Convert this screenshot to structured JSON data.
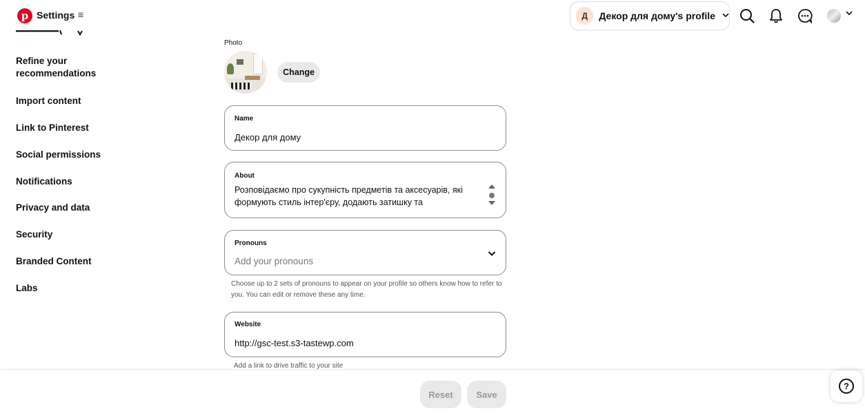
{
  "header": {
    "logo_letter": "p",
    "title": "Settings",
    "menu_glyph": "≡",
    "profile": {
      "initial": "Д",
      "name": "Декор для дому's profile"
    }
  },
  "sidebar": {
    "items": [
      "Refine your recommendations",
      "Import content",
      "Link to Pinterest",
      "Social permissions",
      "Notifications",
      "Privacy and data",
      "Security",
      "Branded Content",
      "Labs"
    ]
  },
  "profile_form": {
    "photo_label": "Photo",
    "change_label": "Change",
    "name": {
      "label": "Name",
      "value": "Декор для дому"
    },
    "about": {
      "label": "About",
      "value": "Розповідаємо про сукупність предметів та аксесуарів, які формують стиль інтер'єру, додають затишку та"
    },
    "pronouns": {
      "label": "Pronouns",
      "placeholder": "Add your pronouns",
      "helper": "Choose up to 2 sets of pronouns to appear on your profile so others know how to refer to you. You can edit or remove these any time."
    },
    "website": {
      "label": "Website",
      "value": "http://gsc-test.s3-tastewp.com",
      "helper": "Add a link to drive traffic to your site"
    }
  },
  "footer": {
    "reset_label": "Reset",
    "save_label": "Save",
    "help_glyph": "?"
  },
  "colors": {
    "brand": "#e60023",
    "border": "#8d8d8d",
    "button_bg": "#e9e9e9"
  }
}
